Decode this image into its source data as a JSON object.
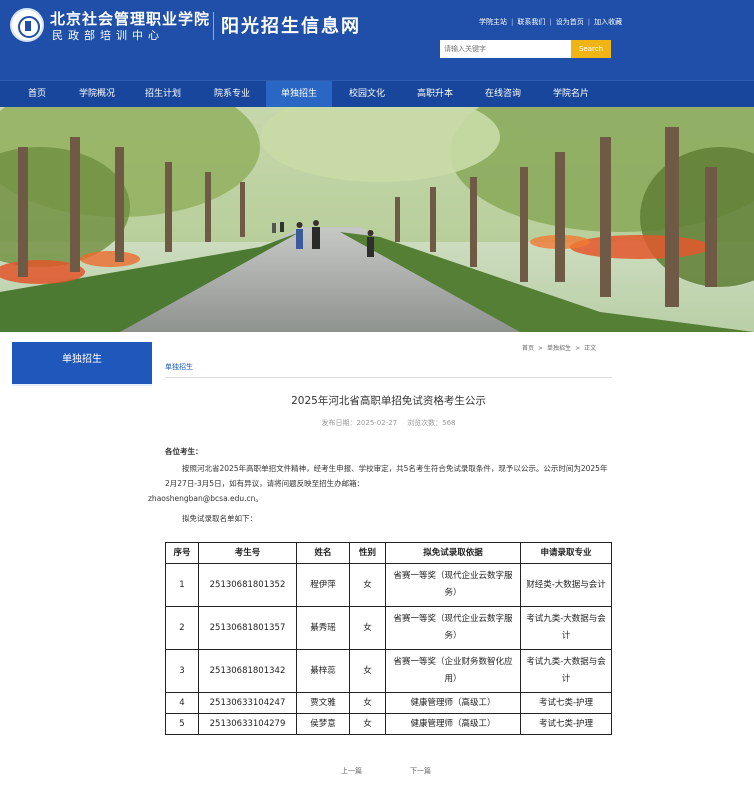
{
  "header": {
    "school_name": "北京社会管理职业学院",
    "school_sub": "民政部培训中心",
    "site_title": "阳光招生信息网",
    "top_links": [
      "学院主站",
      "联系我们",
      "设为首页",
      "加入收藏"
    ],
    "search_placeholder": "请输入关键字",
    "search_button": "Search"
  },
  "nav": {
    "items": [
      "首页",
      "学院概况",
      "招生计划",
      "院系专业",
      "单独招生",
      "校园文化",
      "高职升本",
      "在线咨询",
      "学院名片"
    ],
    "active": "单独招生"
  },
  "sidebar": {
    "heading": "单独招生"
  },
  "breadcrumb": [
    "首页",
    "单独招生",
    "正文"
  ],
  "section_label": "单独招生",
  "article": {
    "title": "2025年河北省高职单招免试资格考生公示",
    "date": "发布日期：2025-02-27",
    "views": "浏览次数：568",
    "greeting": "各位考生：",
    "paragraph": "按照河北省2025年高职单招文件精神，经考生申报、学校审定，共5名考生符合免试录取条件，现予以公示。公示时间为2025年2月27日-3月5日，如有异议，请将问题反映至招生办邮箱：",
    "email": "zhaoshengban@bcsa.edu.cn。",
    "list_intro": "拟免试录取名单如下："
  },
  "table": {
    "headers": [
      "序号",
      "考生号",
      "姓名",
      "性别",
      "拟免试录取依据",
      "申请录取专业"
    ],
    "rows": [
      [
        "1",
        "25130681801352",
        "程伊萍",
        "女",
        "省赛一等奖（现代企业云数字服务）",
        "财经类-大数据与会计"
      ],
      [
        "2",
        "25130681801357",
        "綦秀瑶",
        "女",
        "省赛一等奖（现代企业云数字服务）",
        "考试九类-大数据与会计"
      ],
      [
        "3",
        "25130681801342",
        "綦梓蕊",
        "女",
        "省赛一等奖（企业财务数智化应用）",
        "考试九类-大数据与会计"
      ],
      [
        "4",
        "25130633104247",
        "贾文雅",
        "女",
        "健康管理师（高级工）",
        "考试七类-护理"
      ],
      [
        "5",
        "25130633104279",
        "侯梦意",
        "女",
        "健康管理师（高级工）",
        "考试七类-护理"
      ]
    ]
  },
  "pager": {
    "prev": "上一篇",
    "next": "下一篇"
  },
  "colors": {
    "header_blue": "#1f4fa8",
    "nav_blue": "#17469c",
    "accent_yellow": "#f0b415",
    "link_blue": "#1f57bb"
  },
  "banner_image": "tree-lined-campus-road-photo"
}
